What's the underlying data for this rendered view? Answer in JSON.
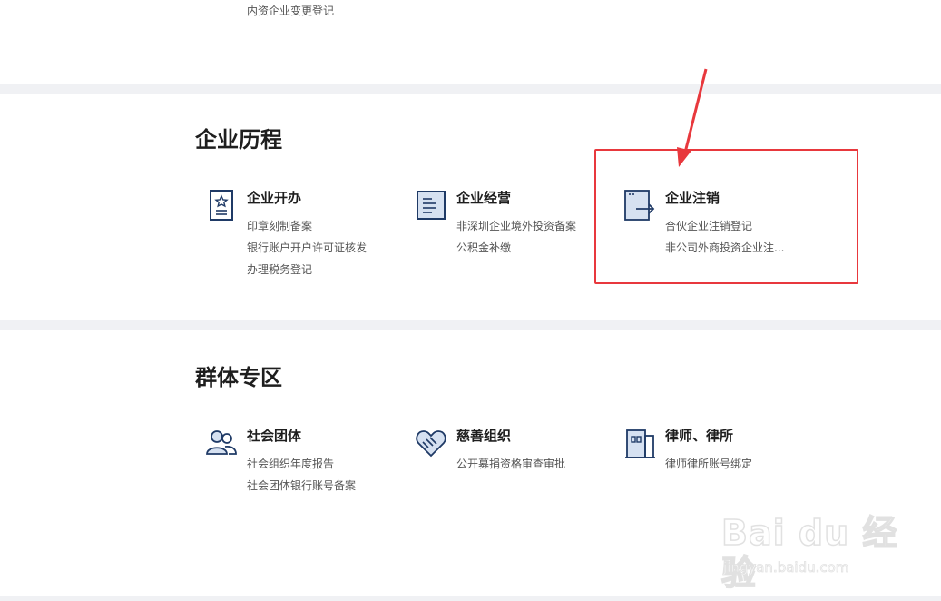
{
  "top_link": "内资企业变更登记",
  "sections": [
    {
      "title": "企业历程",
      "cards": [
        {
          "icon": "certificate-icon",
          "title": "企业开办",
          "links": [
            "印章刻制备案",
            "银行账户开户许可证核发",
            "办理税务登记"
          ]
        },
        {
          "icon": "document-lines-icon",
          "title": "企业经营",
          "links": [
            "非深圳企业境外投资备案",
            "公积金补缴"
          ]
        },
        {
          "icon": "exit-door-icon",
          "title": "企业注销",
          "links": [
            "合伙企业注销登记",
            "非公司外商投资企业注..."
          ]
        }
      ]
    },
    {
      "title": "群体专区",
      "cards": [
        {
          "icon": "people-group-icon",
          "title": "社会团体",
          "links": [
            "社会组织年度报告",
            "社会团体银行账号备案"
          ]
        },
        {
          "icon": "heart-handshake-icon",
          "title": "慈善组织",
          "links": [
            "公开募捐资格审查审批"
          ]
        },
        {
          "icon": "law-office-icon",
          "title": "律师、律所",
          "links": [
            "律师律所账号绑定"
          ]
        }
      ]
    }
  ],
  "annotation": {
    "color": "#e8383d",
    "highlighted": "企业注销"
  },
  "watermark": {
    "brand": "Bai du 经验",
    "url": "jingyan.baidu.com"
  },
  "colors": {
    "icon_stroke": "#1f3a66",
    "icon_fill": "#d6e1f1",
    "band": "#f0f1f4",
    "link_text": "#555555"
  }
}
